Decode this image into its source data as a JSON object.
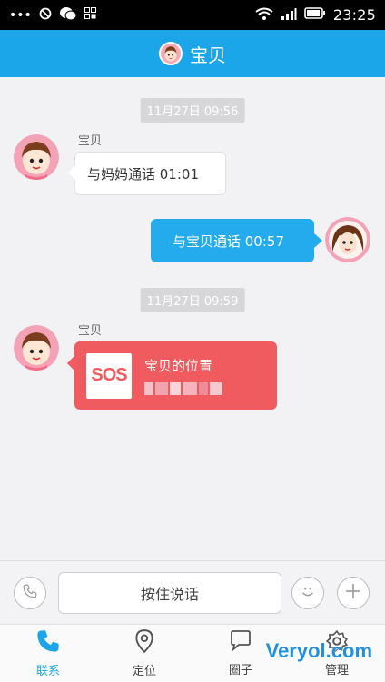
{
  "status_bar": {
    "time": "23:25",
    "dots": "•••",
    "battery_icon": "battery-icon",
    "signal_icon": "signal-icon",
    "wifi_icon": "wifi-icon"
  },
  "header": {
    "title": "宝贝",
    "avatar_icon": "child-avatar-icon"
  },
  "messages": [
    {
      "type": "time",
      "text": "11月27日 09:56"
    },
    {
      "type": "incoming",
      "sender": "宝贝",
      "text": "与妈妈通话  01:01"
    },
    {
      "type": "outgoing",
      "text": "与宝贝通话  00:57"
    },
    {
      "type": "time",
      "text": "11月27日 09:59"
    },
    {
      "type": "sos",
      "sender": "宝贝",
      "badge": "SOS",
      "title": "宝贝的位置"
    }
  ],
  "input_bar": {
    "hold_to_talk": "按住说话",
    "voice_icon": "phone-icon",
    "emoji_icon": "smiley-icon",
    "add_icon": "plus-icon"
  },
  "tabs": [
    {
      "label": "联系",
      "icon": "phone-icon",
      "active": true
    },
    {
      "label": "定位",
      "icon": "location-pin-icon",
      "active": false
    },
    {
      "label": "圈子",
      "icon": "chat-bubble-icon",
      "active": false
    },
    {
      "label": "管理",
      "icon": "gear-icon",
      "active": false
    }
  ],
  "watermark": "Veryol.com",
  "colors": {
    "primary": "#1ba6ea",
    "outgoing_bubble": "#23abee",
    "sos_bubble": "#ef5b5e"
  }
}
